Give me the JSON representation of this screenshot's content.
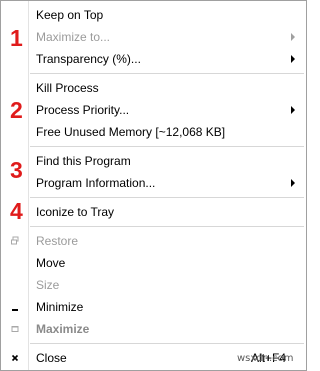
{
  "menu": {
    "groups": [
      {
        "number": "1"
      },
      {
        "number": "2"
      },
      {
        "number": "3"
      },
      {
        "number": "4"
      }
    ],
    "items": [
      {
        "label": "Keep on Top",
        "disabled": false,
        "submenu": false
      },
      {
        "label": "Maximize to...",
        "disabled": true,
        "submenu": true
      },
      {
        "label": "Transparency (%)...",
        "disabled": false,
        "submenu": true
      },
      {
        "label": "Kill Process",
        "disabled": false,
        "submenu": false
      },
      {
        "label": "Process Priority...",
        "disabled": false,
        "submenu": true
      },
      {
        "label": "Free Unused Memory [~12,068 KB]",
        "disabled": false,
        "submenu": false
      },
      {
        "label": "Find this Program",
        "disabled": false,
        "submenu": false
      },
      {
        "label": "Program Information...",
        "disabled": false,
        "submenu": true
      },
      {
        "label": "Iconize to Tray",
        "disabled": false,
        "submenu": false
      },
      {
        "label": "Restore",
        "disabled": true,
        "icon": "restore-icon"
      },
      {
        "label": "Move",
        "disabled": false
      },
      {
        "label": "Size",
        "disabled": true
      },
      {
        "label": "Minimize",
        "disabled": false,
        "icon": "minimize-icon"
      },
      {
        "label": "Maximize",
        "disabled": true,
        "bold": true,
        "icon": "maximize-icon"
      },
      {
        "label": "Close",
        "disabled": false,
        "shortcut": "Alt+F4",
        "icon": "close-icon"
      }
    ]
  },
  "watermark": "wsxdn.com",
  "colors": {
    "annotation": "#e01b1b",
    "disabled_text": "#9b9b9b",
    "separator": "#d7d7d7"
  }
}
